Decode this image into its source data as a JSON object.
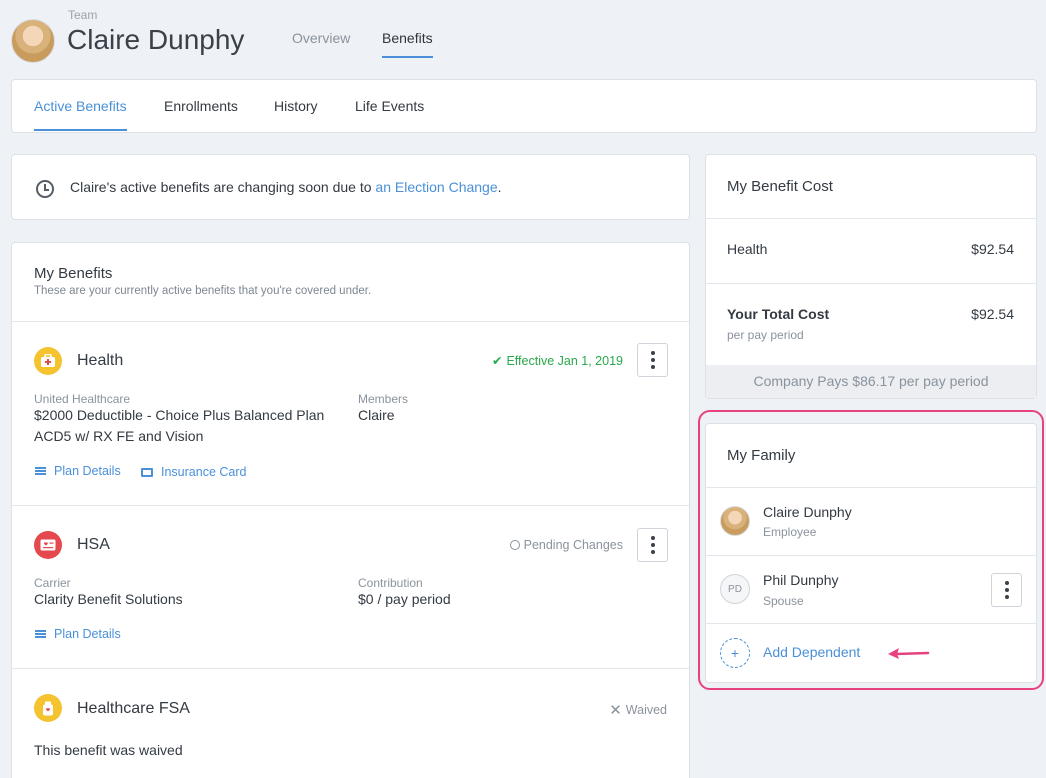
{
  "header": {
    "team_label": "Team",
    "name": "Claire Dunphy",
    "tabs": [
      {
        "label": "Overview",
        "active": false
      },
      {
        "label": "Benefits",
        "active": true
      }
    ]
  },
  "subtabs": [
    {
      "label": "Active Benefits",
      "active": true
    },
    {
      "label": "Enrollments",
      "active": false
    },
    {
      "label": "History",
      "active": false
    },
    {
      "label": "Life Events",
      "active": false
    }
  ],
  "notice": {
    "text": "Claire's active benefits are changing soon due to ",
    "link": "an Election Change",
    "suffix": "."
  },
  "my_benefits": {
    "title": "My Benefits",
    "subtitle": "These are your currently active benefits that you're covered under.",
    "items": [
      {
        "name": "Health",
        "status": "Effective Jan 1, 2019",
        "status_color": "#2aa84a",
        "left_label": "United Healthcare",
        "left_value_1": "$2000 Deductible - Choice Plus Balanced Plan",
        "left_value_2": "ACD5 w/ RX FE and Vision",
        "right_label": "Members",
        "right_value": "Claire",
        "links": [
          "Plan Details",
          "Insurance Card"
        ]
      },
      {
        "name": "HSA",
        "status": "Pending Changes",
        "left_label": "Carrier",
        "left_value_1": "Clarity Benefit Solutions",
        "right_label": "Contribution",
        "right_value": "$0 / pay period",
        "links": [
          "Plan Details"
        ]
      },
      {
        "name": "Healthcare FSA",
        "status": "Waived",
        "note": "This benefit was waived"
      }
    ]
  },
  "cost": {
    "title": "My Benefit Cost",
    "rows": [
      {
        "label": "Health",
        "value": "$92.54"
      }
    ],
    "total_label": "Your Total Cost",
    "total_sub": "per pay period",
    "total_value": "$92.54",
    "company_pays": "Company Pays $86.17 per pay period"
  },
  "family": {
    "title": "My Family",
    "members": [
      {
        "name": "Claire Dunphy",
        "role": "Employee"
      },
      {
        "name": "Phil Dunphy",
        "role": "Spouse",
        "initials": "PD"
      }
    ],
    "add_label": "Add Dependent",
    "add_icon": "+"
  },
  "colors": {
    "accent": "#4a90d9",
    "highlight": "#e8417f",
    "success": "#2aa84a"
  }
}
